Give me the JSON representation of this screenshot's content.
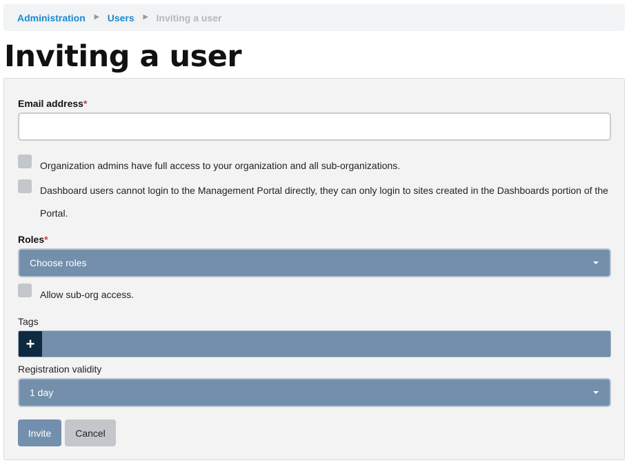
{
  "breadcrumb": {
    "items": [
      {
        "label": "Administration"
      },
      {
        "label": "Users"
      }
    ],
    "current": "Inviting a user",
    "separator": "▶"
  },
  "page": {
    "title": "Inviting a user"
  },
  "form": {
    "email": {
      "label": "Email address",
      "required_mark": "*",
      "value": "",
      "placeholder": ""
    },
    "checkboxes": {
      "org_admin": {
        "label": "Organization admins have full access to your organization and all sub-organizations.",
        "checked": false
      },
      "dashboard": {
        "label_line1": "Dashboard users cannot login to the Management Portal directly, they can only login to sites created in the Dashboards portion of the",
        "label_line2": "Portal.",
        "checked": false
      },
      "suborg": {
        "label": "Allow sub-org access.",
        "checked": false
      }
    },
    "roles": {
      "label": "Roles",
      "required_mark": "*",
      "selected": "Choose roles"
    },
    "tags": {
      "label": "Tags",
      "add_icon_glyph": "+"
    },
    "validity": {
      "label": "Registration validity",
      "selected": "1 day"
    },
    "buttons": {
      "invite": "Invite",
      "cancel": "Cancel"
    }
  },
  "colors": {
    "link": "#1a8ad0",
    "select_bg": "#738fac",
    "tag_add_bg": "#0f2a40",
    "required": "#d9363e"
  }
}
